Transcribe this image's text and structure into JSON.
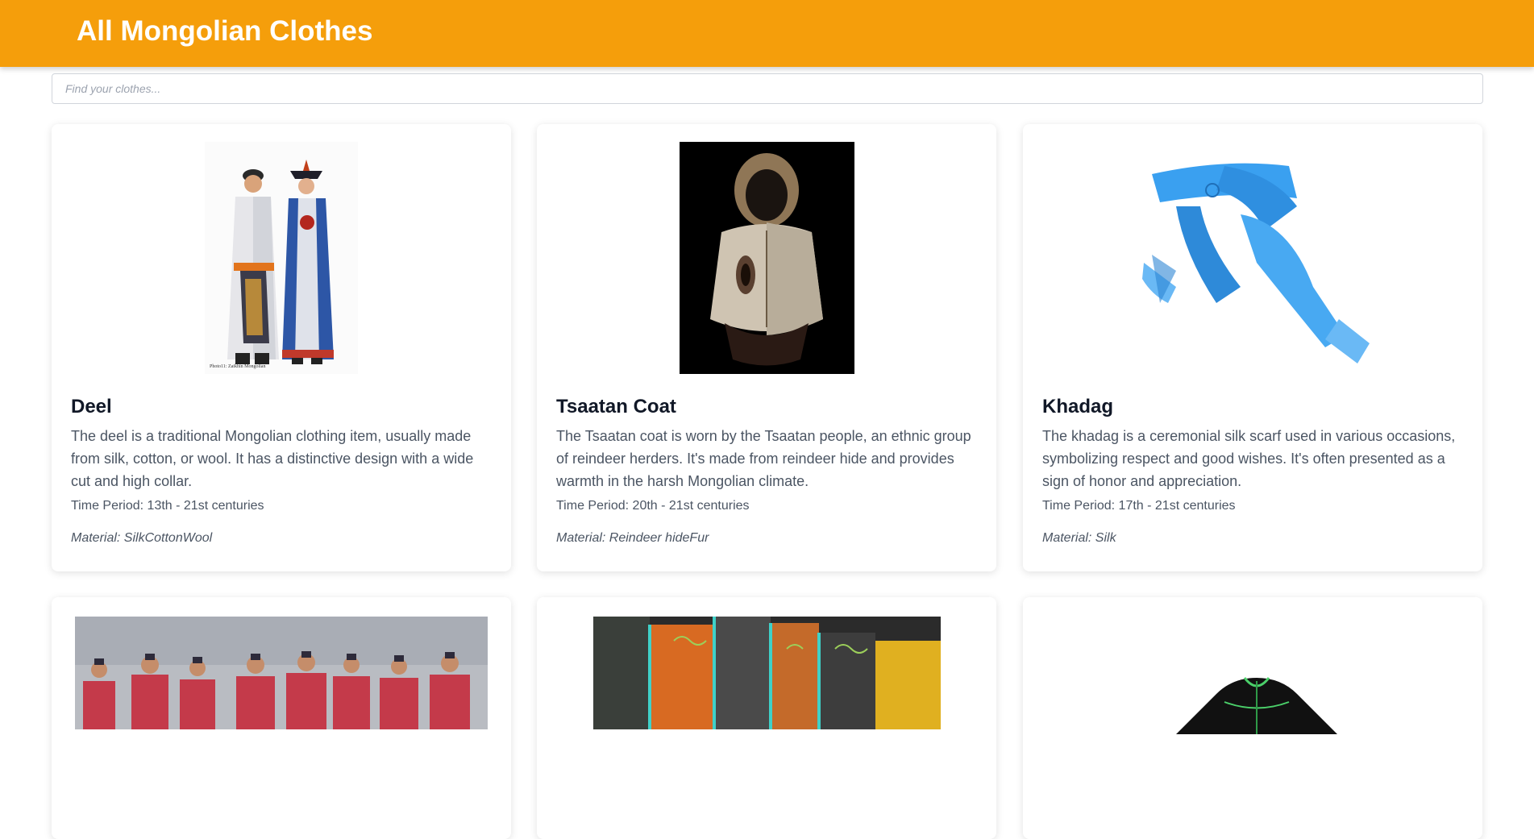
{
  "header": {
    "title": "All Mongolian Clothes"
  },
  "search": {
    "placeholder": "Find your clothes..."
  },
  "cards": [
    {
      "title": "Deel",
      "description": "The deel is a traditional Mongolian clothing item, usually made from silk, cotton, or wool. It has a distinctive design with a wide cut and high collar.",
      "period": "Time Period: 13th - 21st centuries",
      "material": "Material: SilkCottonWool",
      "image_caption": "Photo11: Zaikhin Mongolian"
    },
    {
      "title": "Tsaatan Coat",
      "description": "The Tsaatan coat is worn by the Tsaatan people, an ethnic group of reindeer herders. It's made from reindeer hide and provides warmth in the harsh Mongolian climate.",
      "period": "Time Period: 20th - 21st centuries",
      "material": "Material: Reindeer hideFur"
    },
    {
      "title": "Khadag",
      "description": "The khadag is a ceremonial silk scarf used in various occasions, symbolizing respect and good wishes. It's often presented as a sign of honor and appreciation.",
      "period": "Time Period: 17th - 21st centuries",
      "material": "Material: Silk"
    },
    {
      "title": "",
      "description": "",
      "period": "",
      "material": ""
    },
    {
      "title": "",
      "description": "",
      "period": "",
      "material": ""
    },
    {
      "title": "",
      "description": "",
      "period": "",
      "material": ""
    }
  ],
  "colors": {
    "header_bg": "#f59e0b",
    "header_text": "#ffffff",
    "card_bg": "#ffffff",
    "khadag_blue": "#3aa0f0"
  }
}
